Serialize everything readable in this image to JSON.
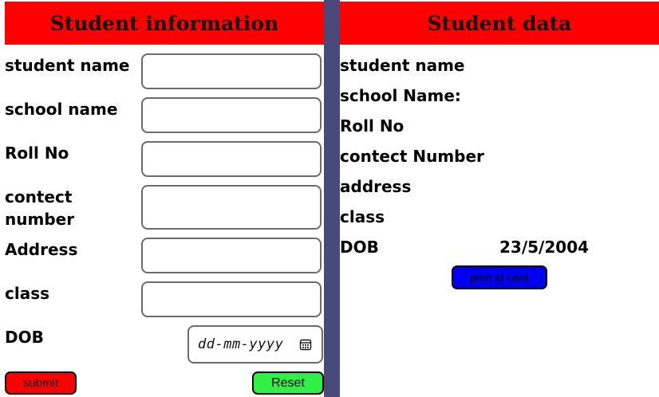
{
  "form": {
    "title": "Student information",
    "fields": {
      "student_name": {
        "label": "student name",
        "value": ""
      },
      "school_name": {
        "label": "school name",
        "value": ""
      },
      "roll_no": {
        "label": "Roll No",
        "value": ""
      },
      "contact_number": {
        "label": "contect number",
        "value": ""
      },
      "address": {
        "label": "Address",
        "value": ""
      },
      "class": {
        "label": "class",
        "value": ""
      },
      "dob": {
        "label": "DOB",
        "placeholder": "dd-mm-yyyy"
      }
    },
    "submit_label": "submit",
    "reset_label": "Reset",
    "colors": {
      "header": "#ff0000",
      "submit": "#ff0000",
      "reset": "#33ee44",
      "divider": "#4a4a7a"
    }
  },
  "display": {
    "title": "Student data",
    "student_name_label": "student name",
    "school_name_label": "school Name:",
    "roll_no_label": "Roll No",
    "contact_number_label": "contect Number",
    "address_label": "address",
    "class_label": "class",
    "dob_label": "DOB",
    "dob_value": "23/5/2004",
    "print_label": "print id card",
    "print_color": "#0000ee"
  }
}
